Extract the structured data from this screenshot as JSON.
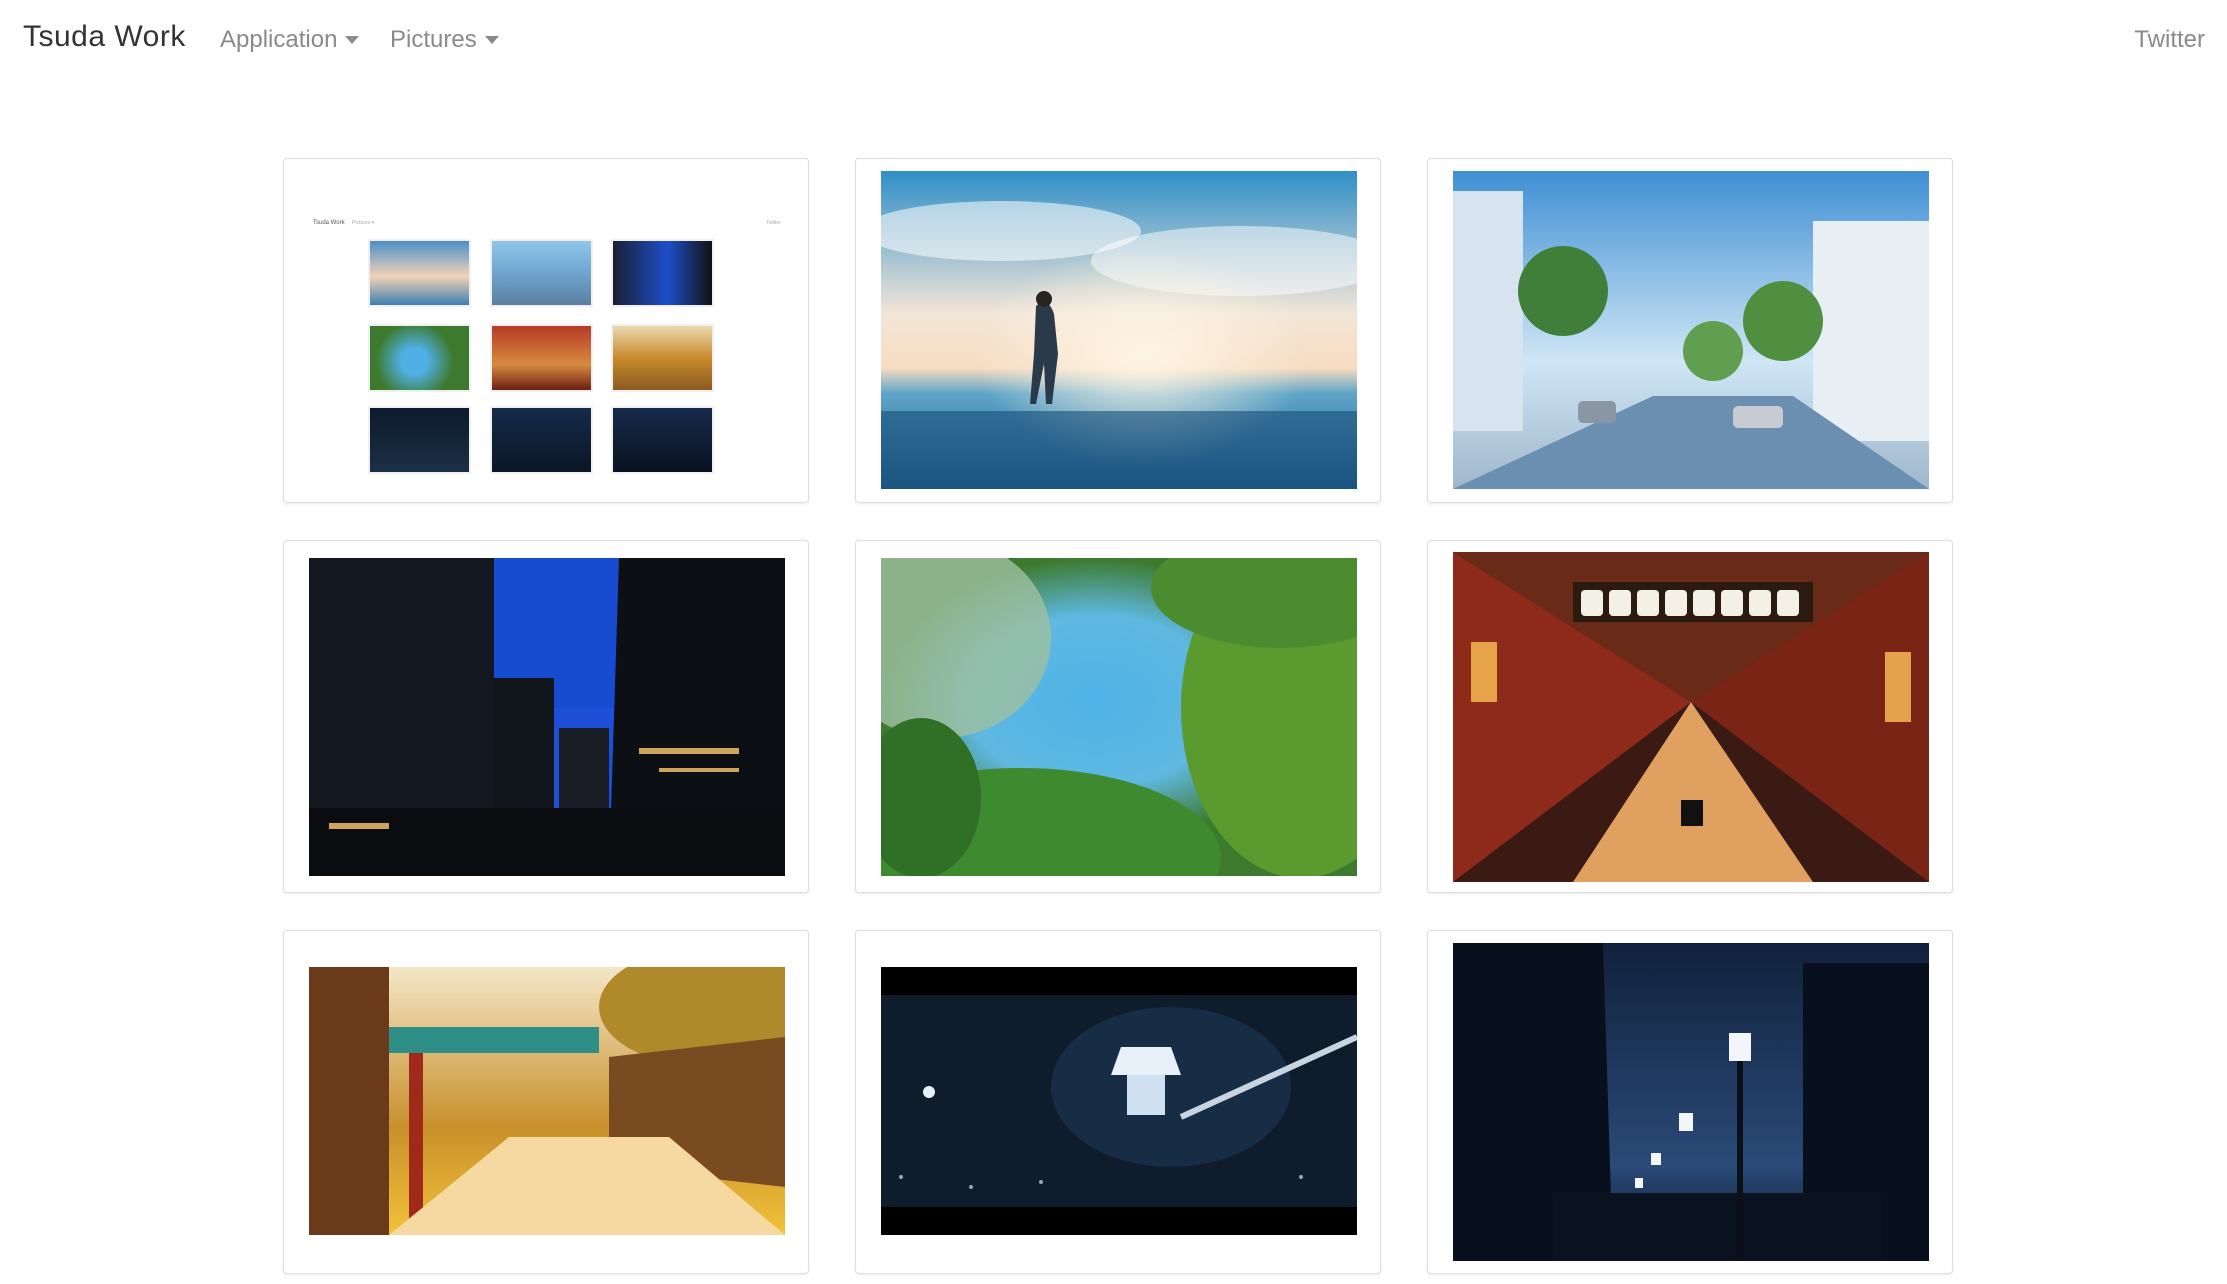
{
  "navbar": {
    "brand": "Tsuda Work",
    "items": [
      {
        "label": "Application"
      },
      {
        "label": "Pictures"
      }
    ],
    "right_link": "Twitter"
  },
  "gallery": {
    "cards": [
      {
        "name": "site-screenshot",
        "alt": ""
      },
      {
        "name": "beach-sunset",
        "alt": ""
      },
      {
        "name": "city-street-blue-sky",
        "alt": ""
      },
      {
        "name": "ginza-buildings",
        "alt": ""
      },
      {
        "name": "forest-canopy",
        "alt": ""
      },
      {
        "name": "shopping-arcade-lanterns",
        "alt": ""
      },
      {
        "name": "market-street-golden",
        "alt": ""
      },
      {
        "name": "night-lantern",
        "alt": ""
      },
      {
        "name": "night-street-lamps",
        "alt": ""
      }
    ],
    "thumbnail_brand": "Tsuda Work",
    "thumbnail_nav": "Pictures ▾",
    "thumbnail_right": "Twitter"
  },
  "colors": {
    "text_dark": "#333333",
    "text_muted": "#8a8a8a",
    "card_border": "#dedede"
  }
}
